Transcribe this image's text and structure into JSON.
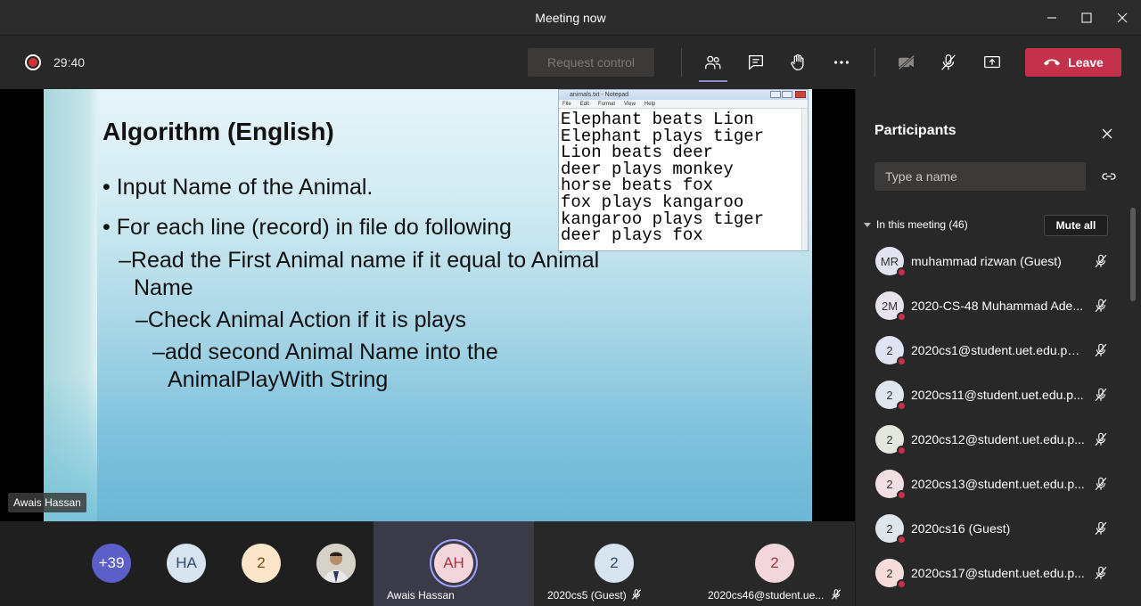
{
  "window": {
    "title": "Meeting now"
  },
  "toolbar": {
    "timer": "29:40",
    "request_control": "Request control",
    "leave": "Leave"
  },
  "slide": {
    "title": "Algorithm (English)",
    "lines": [
      "• Input Name of the Animal.",
      "• For each line (record) in file do following",
      "–Read the First Animal name if it equal to Animal",
      "Name",
      "–Check Animal Action if it is plays",
      "–add second Animal Name into the",
      "AnimalPlayWith String"
    ],
    "notepad": {
      "title": "animals.txt - Notepad",
      "menu": [
        "File",
        "Edit",
        "Format",
        "View",
        "Help"
      ],
      "lines": [
        "Elephant beats Lion",
        "Elephant plays tiger",
        "Lion beats deer",
        "deer plays monkey",
        "horse beats fox",
        "fox plays kangaroo",
        "kangaroo plays tiger",
        "deer plays fox"
      ]
    },
    "presenter_tag": "Awais Hassan"
  },
  "strip": {
    "overflow": "+39",
    "avatars": [
      "HA",
      "2"
    ],
    "tiles": [
      {
        "initials": "AH",
        "label": "Awais Hassan"
      },
      {
        "initials": "2",
        "label": "2020cs5 (Guest)"
      },
      {
        "initials": "2",
        "label": "2020cs46@student.ue..."
      }
    ]
  },
  "panel": {
    "title": "Participants",
    "search_placeholder": "Type a name",
    "section": "In this meeting (46)",
    "mute_all": "Mute all",
    "participants": [
      {
        "initials": "MR",
        "name": "muhammad rizwan (Guest)",
        "color": "#e1e3f2"
      },
      {
        "initials": "2M",
        "name": "2020-CS-48 Muhammad Ade...",
        "color": "#e8e3ee"
      },
      {
        "initials": "2",
        "name": "2020cs1@student.uet.edu.pk ...",
        "color": "#dfe3f3"
      },
      {
        "initials": "2",
        "name": "2020cs11@student.uet.edu.p...",
        "color": "#dfe6f0"
      },
      {
        "initials": "2",
        "name": "2020cs12@student.uet.edu.p...",
        "color": "#e4e8dc"
      },
      {
        "initials": "2",
        "name": "2020cs13@student.uet.edu.p...",
        "color": "#f2dfe3"
      },
      {
        "initials": "2",
        "name": "2020cs16 (Guest)",
        "color": "#dde6ec"
      },
      {
        "initials": "2",
        "name": "2020cs17@student.uet.edu.p...",
        "color": "#f7ddd9"
      }
    ]
  },
  "colors": {
    "accent": "#8b8cc7",
    "leave": "#c4314b",
    "overflow_avatar": "#5b5fc7"
  }
}
